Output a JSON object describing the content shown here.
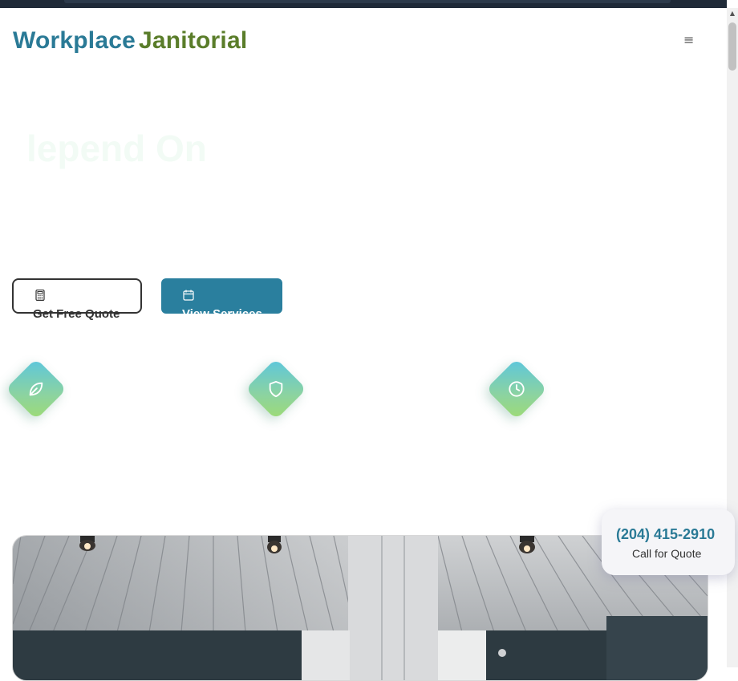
{
  "logo": {
    "word1": "Workplace",
    "word2": "Janitorial"
  },
  "header": {
    "menu_glyph": "≡"
  },
  "hero": {
    "headline_fragment": "lepend On"
  },
  "buttons": {
    "quote_label": "Get Free Quote",
    "quote_icon": "calculator-icon",
    "services_label": "View Services",
    "services_icon": "calendar-icon"
  },
  "features": [
    {
      "icon": "leaf-icon"
    },
    {
      "icon": "shield-icon"
    },
    {
      "icon": "clock-icon"
    }
  ],
  "photo": {
    "subject": "office-interior-image"
  },
  "call_card": {
    "phone": "(204) 415-2910",
    "label": "Call for Quote"
  },
  "colors": {
    "brand_blue": "#2a7a96",
    "brand_green": "#5a7d2a",
    "button_blue": "#2a7f9e",
    "gradient_start": "#5bc6de",
    "gradient_end": "#9edb73"
  }
}
